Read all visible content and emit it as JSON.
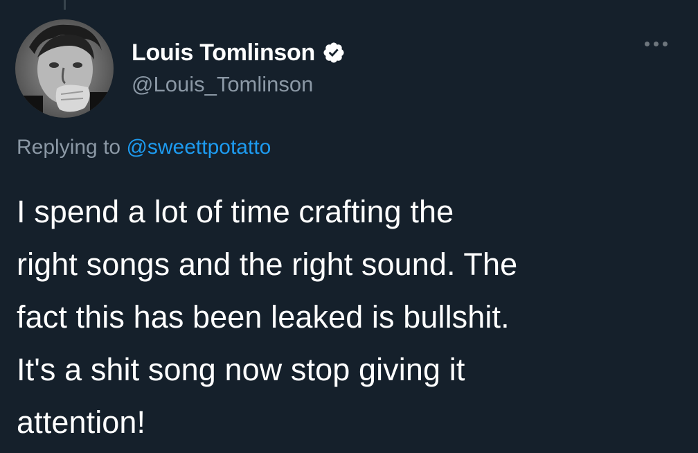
{
  "tweet": {
    "author": {
      "display_name": "Louis Tomlinson",
      "handle": "@Louis_Tomlinson",
      "verified": true
    },
    "reply": {
      "prefix": "Replying to",
      "mention": "@sweettpotatto"
    },
    "text_lines": [
      "I spend a lot of time crafting the",
      "right songs and the right sound. The",
      "fact this has been leaked is bullshit.",
      "It's a shit song now stop giving it",
      "attention!"
    ]
  },
  "icons": {
    "verified": "verified-badge-icon",
    "more": "more-options-icon"
  },
  "colors": {
    "background": "#15202b",
    "secondary_text": "#8b98a5",
    "link": "#1d9bf0",
    "primary_text": "#ffffff"
  }
}
